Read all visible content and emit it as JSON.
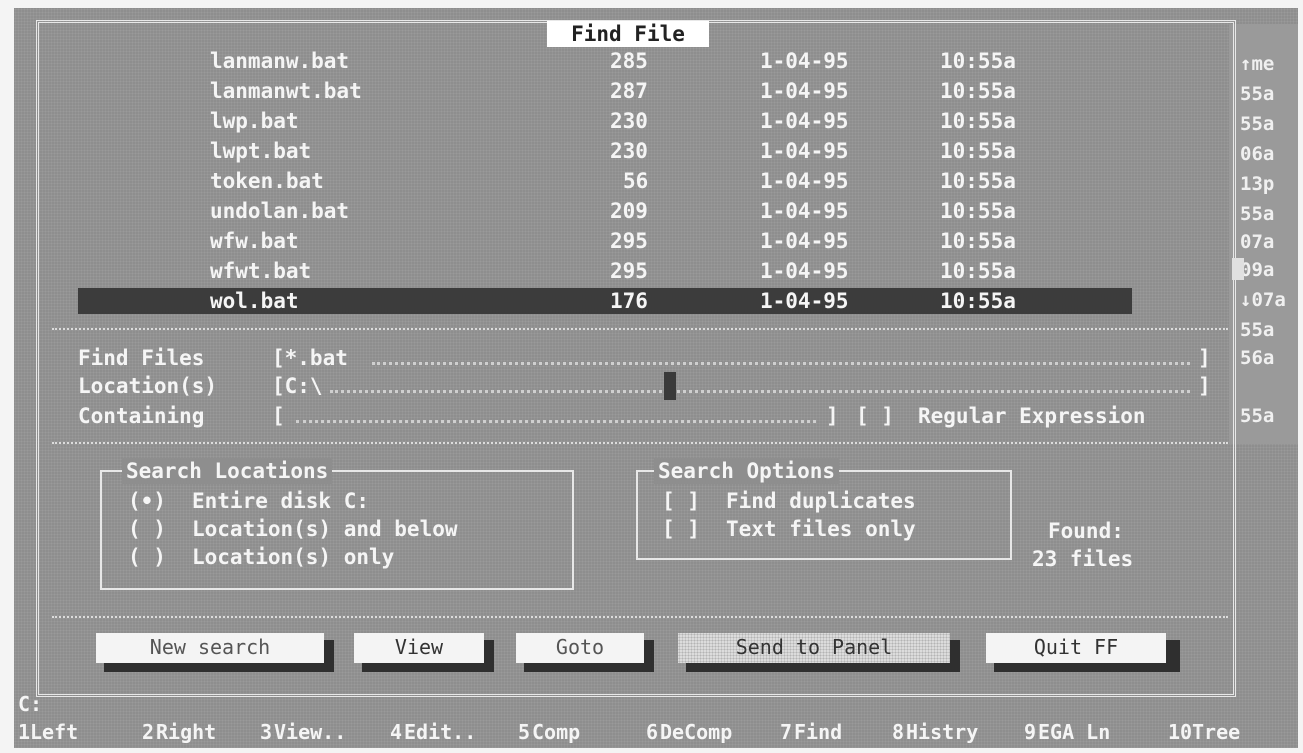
{
  "dialog": {
    "title": "Find File"
  },
  "file_list": {
    "rows": [
      {
        "name": "lanmanw.bat",
        "size": "285",
        "date": "1-04-95",
        "time": "10:55a"
      },
      {
        "name": "lanmanwt.bat",
        "size": "287",
        "date": "1-04-95",
        "time": "10:55a"
      },
      {
        "name": "lwp.bat",
        "size": "230",
        "date": "1-04-95",
        "time": "10:55a"
      },
      {
        "name": "lwpt.bat",
        "size": "230",
        "date": "1-04-95",
        "time": "10:55a"
      },
      {
        "name": "token.bat",
        "size": "56",
        "date": "1-04-95",
        "time": "10:55a"
      },
      {
        "name": "undolan.bat",
        "size": "209",
        "date": "1-04-95",
        "time": "10:55a"
      },
      {
        "name": "wfw.bat",
        "size": "295",
        "date": "1-04-95",
        "time": "10:55a"
      },
      {
        "name": "wfwt.bat",
        "size": "295",
        "date": "1-04-95",
        "time": "10:55a"
      },
      {
        "name": "wol.bat",
        "size": "176",
        "date": "1-04-95",
        "time": "10:55a"
      }
    ],
    "selected_index": 8
  },
  "background_panel": {
    "column": [
      "↑me",
      "55a",
      "55a",
      "06a",
      "13p",
      "55a",
      "07a",
      "09a",
      "↓07a",
      "55a",
      "56a",
      "55a"
    ]
  },
  "search": {
    "find_files_label": "Find Files",
    "find_files_value": "[*.bat",
    "location_label": "Location(s)",
    "location_value": "[C:\\",
    "containing_label": "Containing",
    "containing_value": "[",
    "bracket_close": "]",
    "regex_checkbox": "[ ]",
    "regex_label": "Regular Expression"
  },
  "search_locations": {
    "title": "Search Locations",
    "options": [
      {
        "mark": "(•)",
        "label": "Entire disk C:"
      },
      {
        "mark": "( )",
        "label": "Location(s) and below"
      },
      {
        "mark": "( )",
        "label": "Location(s) only"
      }
    ]
  },
  "search_options": {
    "title": "Search Options",
    "options": [
      {
        "mark": "[ ]",
        "label": "Find duplicates"
      },
      {
        "mark": "[ ]",
        "label": "Text files only"
      }
    ]
  },
  "found": {
    "label": "Found:",
    "value": "23 files"
  },
  "buttons": {
    "new_search": "New search",
    "view": "View",
    "goto": "Goto",
    "send_to_panel": "Send to Panel",
    "quit": "Quit FF"
  },
  "prompt": "C:",
  "function_keys": [
    {
      "num": "1",
      "label": "Left"
    },
    {
      "num": "2",
      "label": "Right"
    },
    {
      "num": "3",
      "label": "View.."
    },
    {
      "num": "4",
      "label": "Edit.."
    },
    {
      "num": "5",
      "label": "Comp"
    },
    {
      "num": "6",
      "label": "DeComp"
    },
    {
      "num": "7",
      "label": "Find"
    },
    {
      "num": "8",
      "label": "Histry"
    },
    {
      "num": "9",
      "label": "EGA Ln"
    },
    {
      "num": "10",
      "label": "Tree"
    }
  ]
}
